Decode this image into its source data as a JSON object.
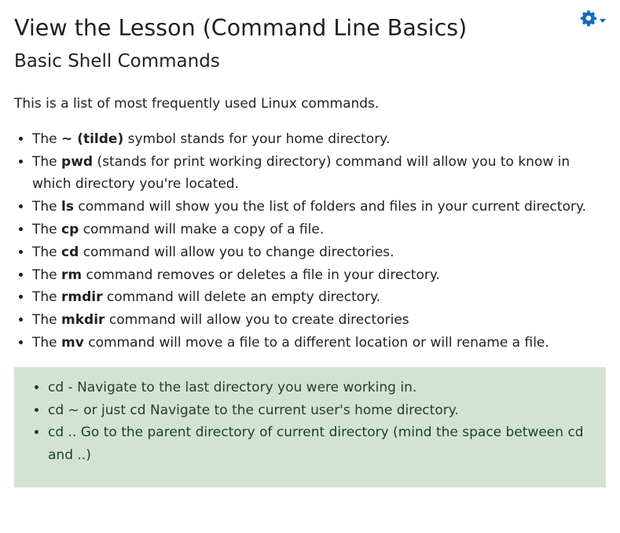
{
  "header": {
    "page_title": "View the Lesson (Command Line Basics)",
    "settings_icon": "gear-icon",
    "accent_color": "#0f6cbf"
  },
  "lesson": {
    "title": "Basic Shell Commands",
    "intro": "This is a list of most frequently used Linux commands.",
    "commands": [
      {
        "prefix": "The",
        "command": "~ (tilde)",
        "description": "symbol stands for your home directory."
      },
      {
        "prefix": "The",
        "command": "pwd",
        "description": "(stands for print working directory) command will allow you to know in which directory you're located."
      },
      {
        "prefix": "The",
        "command": "ls",
        "description": "command will show you the list of folders and files in your current directory."
      },
      {
        "prefix": "The",
        "command": "cp",
        "description": "command will make a copy of a file."
      },
      {
        "prefix": "The",
        "command": "cd",
        "description": "command will allow you to change directories."
      },
      {
        "prefix": "The",
        "command": "rm",
        "description": "command removes or deletes a file in your directory."
      },
      {
        "prefix": "The",
        "command": "rmdir",
        "description": "command will delete an empty directory."
      },
      {
        "prefix": "The",
        "command": "mkdir",
        "description": "command will allow you to create directories"
      },
      {
        "prefix": "The",
        "command": "mv",
        "description": "command will move a file to a different location or will rename a file."
      }
    ],
    "tips_background": "#d2e3d5",
    "tips": [
      "cd - Navigate to the last directory you were working in.",
      "cd ~ or just cd Navigate to the current user's home directory.",
      "cd .. Go to the parent directory of current directory (mind the space between cd and ..)"
    ]
  }
}
